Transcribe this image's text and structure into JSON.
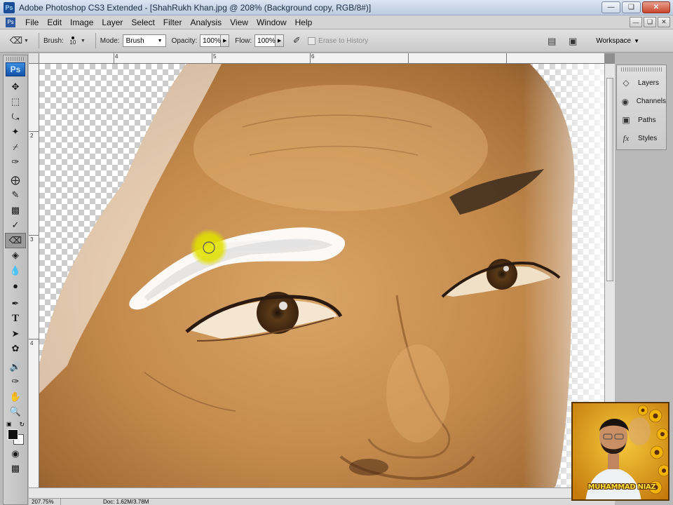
{
  "window": {
    "title": "Adobe Photoshop CS3 Extended - [ShahRukh Khan.jpg @ 208% (Background copy, RGB/8#)]",
    "app_icon": "Ps"
  },
  "menubar": {
    "items": [
      "File",
      "Edit",
      "Image",
      "Layer",
      "Select",
      "Filter",
      "Analysis",
      "View",
      "Window",
      "Help"
    ]
  },
  "options": {
    "brush_label": "Brush:",
    "brush_size": "10",
    "mode_label": "Mode:",
    "mode_value": "Brush",
    "opacity_label": "Opacity:",
    "opacity_value": "100%",
    "flow_label": "Flow:",
    "flow_value": "100%",
    "erase_history_label": "Erase to History",
    "workspace_label": "Workspace"
  },
  "toolbox": {
    "logo": "Ps",
    "tools": [
      "move-tool-icon",
      "marquee-tool-icon",
      "lasso-tool-icon",
      "magic-wand-tool-icon",
      "crop-tool-icon",
      "eyedropper-tool-icon",
      "healing-brush-tool-icon",
      "brush-tool-icon",
      "clone-stamp-tool-icon",
      "history-brush-tool-icon",
      "eraser-tool-icon",
      "paint-bucket-tool-icon",
      "blur-tool-icon",
      "dodge-tool-icon",
      "pen-tool-icon",
      "type-tool-icon",
      "path-selection-tool-icon",
      "custom-shape-tool-icon",
      "notes-tool-icon",
      "hand-tool-icon",
      "zoom-tool-icon"
    ],
    "active_tool": "eraser-tool-icon",
    "foreground_color": "#111111",
    "background_color": "#ffffff"
  },
  "rulers": {
    "top_labels": [
      "4",
      "5",
      "6"
    ],
    "left_labels": [
      "2",
      "3",
      "4"
    ]
  },
  "panel": {
    "items": [
      {
        "label": "Layers",
        "icon": "layers-icon"
      },
      {
        "label": "Channels",
        "icon": "channels-icon"
      },
      {
        "label": "Paths",
        "icon": "paths-icon"
      },
      {
        "label": "Styles",
        "icon": "styles-icon"
      }
    ]
  },
  "statusbar": {
    "zoom": "207.75%",
    "doc": "Doc: 1.62M/3.78M"
  },
  "watermark": {
    "name": "MUHAMMAD NIAZ"
  }
}
